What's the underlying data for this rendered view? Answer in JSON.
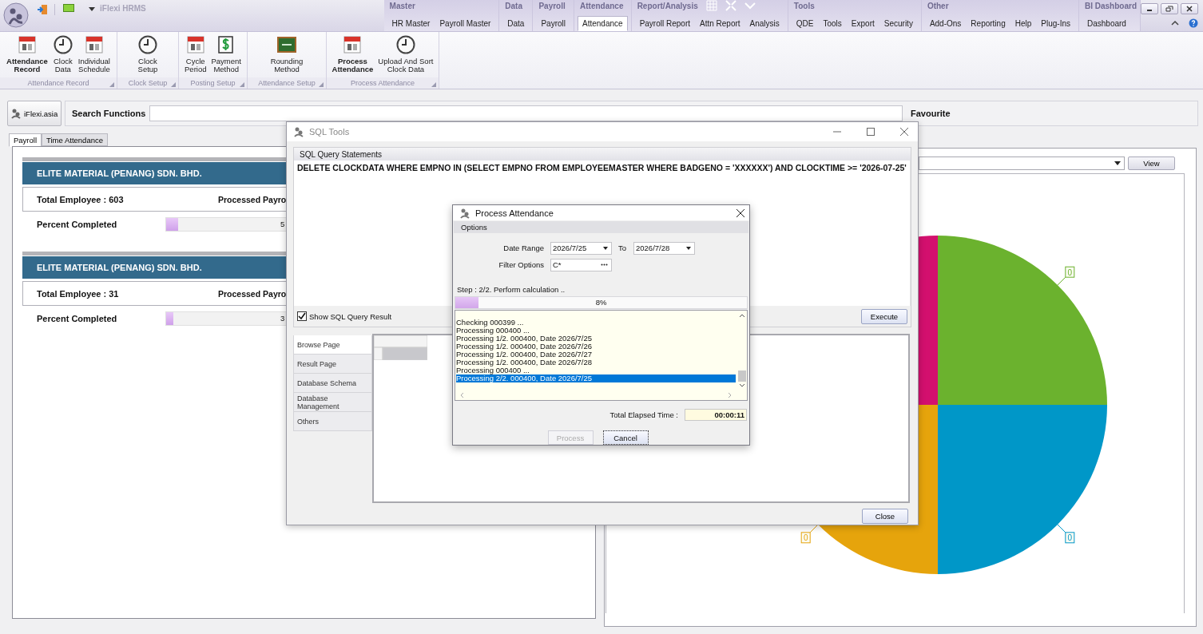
{
  "app": {
    "title": "iFlexi HRMS"
  },
  "menu_groups": [
    {
      "label": "Master",
      "tabs": [
        {
          "label": "HR Master",
          "selected": false
        },
        {
          "label": "Payroll Master",
          "selected": false
        }
      ]
    },
    {
      "label": "Data",
      "tabs": [
        {
          "label": "Data",
          "selected": false
        }
      ]
    },
    {
      "label": "Payroll",
      "tabs": [
        {
          "label": "Payroll",
          "selected": false
        }
      ]
    },
    {
      "label": "Attendance",
      "tabs": [
        {
          "label": "Attendance",
          "selected": true
        }
      ]
    },
    {
      "label": "Report/Analysis",
      "tabs": [
        {
          "label": "Payroll Report",
          "selected": false
        },
        {
          "label": "Attn Report",
          "selected": false
        },
        {
          "label": "Analysis",
          "selected": false
        }
      ]
    },
    {
      "label": "Tools",
      "tabs": [
        {
          "label": "QDE",
          "selected": false
        },
        {
          "label": "Tools",
          "selected": false
        },
        {
          "label": "Export",
          "selected": false
        },
        {
          "label": "Security",
          "selected": false
        }
      ]
    },
    {
      "label": "Other",
      "tabs": [
        {
          "label": "Add-Ons",
          "selected": false
        },
        {
          "label": "Reporting",
          "selected": false
        },
        {
          "label": "Help",
          "selected": false
        },
        {
          "label": "Plug-Ins",
          "selected": false
        }
      ]
    },
    {
      "label": "BI Dashboard",
      "tabs": [
        {
          "label": "Dashboard",
          "selected": false
        }
      ]
    }
  ],
  "ribbon": [
    {
      "label": "Attendance Record",
      "buttons": [
        {
          "lines": [
            "Attendance",
            "Record"
          ],
          "selected": true
        },
        {
          "lines": [
            "Clock",
            "Data"
          ],
          "selected": false
        },
        {
          "lines": [
            "Individual",
            "Schedule"
          ],
          "selected": false
        }
      ]
    },
    {
      "label": "Clock Setup",
      "buttons": [
        {
          "lines": [
            "Clock",
            "Setup"
          ],
          "selected": false
        }
      ]
    },
    {
      "label": "Posting Setup",
      "buttons": [
        {
          "lines": [
            "Cycle",
            "Period"
          ],
          "selected": false
        },
        {
          "lines": [
            "Payment",
            "Method"
          ],
          "selected": false
        }
      ]
    },
    {
      "label": "Attendance Setup",
      "buttons": [
        {
          "lines": [
            "Rounding",
            "Method"
          ],
          "selected": false
        }
      ]
    },
    {
      "label": "Process Attendance",
      "buttons": [
        {
          "lines": [
            "Process",
            "Attendance"
          ],
          "selected": true
        },
        {
          "lines": [
            "Upload And Sort",
            "Clock Data"
          ],
          "selected": false
        }
      ]
    }
  ],
  "search": {
    "brand_button": "iFlexi.asia",
    "label": "Search Functions",
    "favourite": "Favourite"
  },
  "tabs": [
    {
      "label": "Payroll",
      "selected": true
    },
    {
      "label": "Time Attendance",
      "selected": false
    }
  ],
  "companies": [
    {
      "name": "ELITE MATERIAL (PENANG) SDN. BHD.",
      "total": "Total Employee : 603",
      "processed": "Processed Payro",
      "percent_label": "Percent Completed",
      "level": 0.05,
      "reading": "5"
    },
    {
      "name": "ELITE MATERIAL (PENANG) SDN. BHD.",
      "total": "Total Employee : 31",
      "processed": "Processed Payro",
      "percent_label": "Percent Completed",
      "level": 0.03,
      "reading": "3"
    }
  ],
  "chart": {
    "view_button": "View",
    "slices": [
      {
        "color": "#6bb22e",
        "label": "0"
      },
      {
        "color": "#0097c8",
        "label": "0"
      },
      {
        "color": "#e6a40c",
        "label": "0"
      },
      {
        "color": "#d3106e"
      }
    ]
  },
  "sql_tools": {
    "title": "SQL Tools",
    "section": "SQL Query Statements",
    "query": "DELETE CLOCKDATA WHERE EMPNO IN (SELECT EMPNO FROM EMPLOYEEMASTER WHERE BADGENO = 'XXXXXX') AND CLOCKTIME >= '2026-07-25'",
    "show_result": {
      "label": "Show SQL Query Result",
      "checked": true
    },
    "execute_button": "Execute",
    "pages": [
      {
        "label": "Browse Page",
        "selected": true
      },
      {
        "label": "Result Page",
        "selected": false
      },
      {
        "label": "Database Schema",
        "selected": false
      },
      {
        "label": "Database Management",
        "selected": false
      },
      {
        "label": "Others",
        "selected": false
      }
    ],
    "close_button": "Close"
  },
  "process_attendance": {
    "title": "Process Attendance",
    "options_label": "Options",
    "date_range_label": "Date Range",
    "date_from": "2026/7/25",
    "to_label": "To",
    "date_to": "2026/7/28",
    "filter_label": "Filter Options",
    "filter_value": "C*",
    "step": "Step : 2/2. Perform calculation ..",
    "level": 0.08,
    "reading": "8%",
    "log": [
      {
        "text": "Checking 000399 ...",
        "selected": false
      },
      {
        "text": "Processing 000400 ...",
        "selected": false
      },
      {
        "text": "Processing 1/2. 000400, Date 2026/7/25",
        "selected": false
      },
      {
        "text": "Processing 1/2. 000400, Date 2026/7/26",
        "selected": false
      },
      {
        "text": "Processing 1/2. 000400, Date 2026/7/27",
        "selected": false
      },
      {
        "text": "Processing 1/2. 000400, Date 2026/7/28",
        "selected": false
      },
      {
        "text": "Processing 000400 ...",
        "selected": false
      },
      {
        "text": "Processing 2/2. 000400, Date 2026/7/25",
        "selected": true
      }
    ],
    "elapsed_label": "Total Elapsed Time :",
    "elapsed": "00:00:11",
    "buttons": [
      {
        "label": "Process",
        "disabled": true
      },
      {
        "label": "Cancel",
        "disabled": false
      }
    ]
  }
}
